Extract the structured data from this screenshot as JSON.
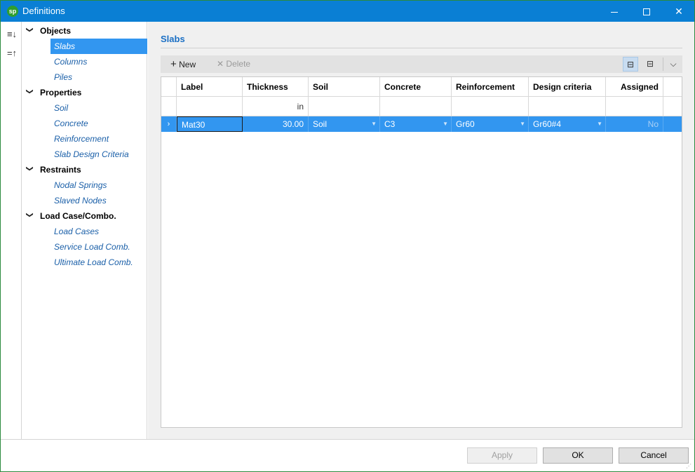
{
  "window": {
    "title": "Definitions",
    "app_icon_text": "sp",
    "minimize_icon": "minimize-icon",
    "maximize_icon": "maximize-icon",
    "close_icon": "close-icon",
    "close_glyph": "✕"
  },
  "left_toolbar": {
    "expand_icon": "sort-expand-icon",
    "expand_glyph": "≡↓",
    "collapse_icon": "sort-collapse-icon",
    "collapse_glyph": "=↑"
  },
  "tree": {
    "groups": [
      {
        "label": "Objects",
        "items": [
          "Slabs",
          "Columns",
          "Piles"
        ]
      },
      {
        "label": "Properties",
        "items": [
          "Soil",
          "Concrete",
          "Reinforcement",
          "Slab Design Criteria"
        ]
      },
      {
        "label": "Restraints",
        "items": [
          "Nodal Springs",
          "Slaved Nodes"
        ]
      },
      {
        "label": "Load Case/Combo.",
        "items": [
          "Load Cases",
          "Service Load Comb.",
          "Ultimate Load Comb."
        ]
      }
    ],
    "selected": "Slabs",
    "chevron_glyph": "❯"
  },
  "main": {
    "section_title": "Slabs",
    "toolbar": {
      "new_label": "New",
      "new_glyph": "+",
      "delete_label": "Delete",
      "delete_glyph": "✕",
      "view_icon_1_glyph": "⊟",
      "view_icon_2_glyph": "⊟",
      "more_glyph": "⌵"
    },
    "grid": {
      "headers": [
        "Label",
        "Thickness",
        "Soil",
        "Concrete",
        "Reinforcement",
        "Design criteria",
        "Assigned"
      ],
      "units": [
        "",
        "in",
        "",
        "",
        "",
        "",
        ""
      ],
      "rows": [
        {
          "indicator": "›",
          "label": "Mat30",
          "thickness": "30.00",
          "soil": "Soil",
          "concrete": "C3",
          "reinforcement": "Gr60",
          "design_criteria": "Gr60#4",
          "assigned": "No"
        }
      ],
      "dropdown_glyph": "▼"
    }
  },
  "footer": {
    "apply_label": "Apply",
    "ok_label": "OK",
    "cancel_label": "Cancel",
    "grip_glyph": "⋰"
  },
  "colors": {
    "titlebar": "#0a7fd4",
    "selection": "#3296f0",
    "section_title": "#1a6fc4",
    "tree_item_text": "#1a5fa8"
  }
}
